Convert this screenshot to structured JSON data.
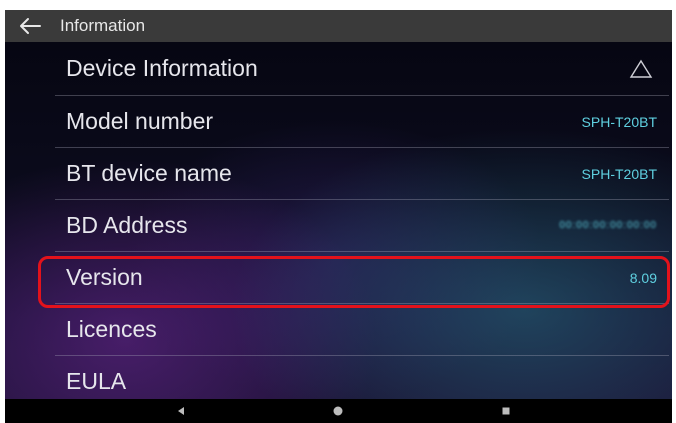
{
  "header": {
    "title": "Information",
    "back_icon": "arrow-left-icon"
  },
  "section": {
    "title": "Device Information",
    "collapse_icon": "triangle-up-icon"
  },
  "rows": [
    {
      "label": "Model number",
      "value": "SPH-T20BT"
    },
    {
      "label": "BT device name",
      "value": "SPH-T20BT"
    },
    {
      "label": "BD Address",
      "value": "00:00:00:00:00:00"
    },
    {
      "label": "Version",
      "value": "8.09"
    },
    {
      "label": "Licences",
      "value": ""
    },
    {
      "label": "EULA",
      "value": ""
    }
  ],
  "navbar": {
    "back_icon": "triangle-back-icon",
    "home_icon": "circle-home-icon",
    "recents_icon": "square-recents-icon"
  },
  "colors": {
    "header_bg": "#3a3a3a",
    "value_text": "#5fd0e0",
    "highlight_border": "#e3121b",
    "label_text": "#e6e6ec"
  }
}
